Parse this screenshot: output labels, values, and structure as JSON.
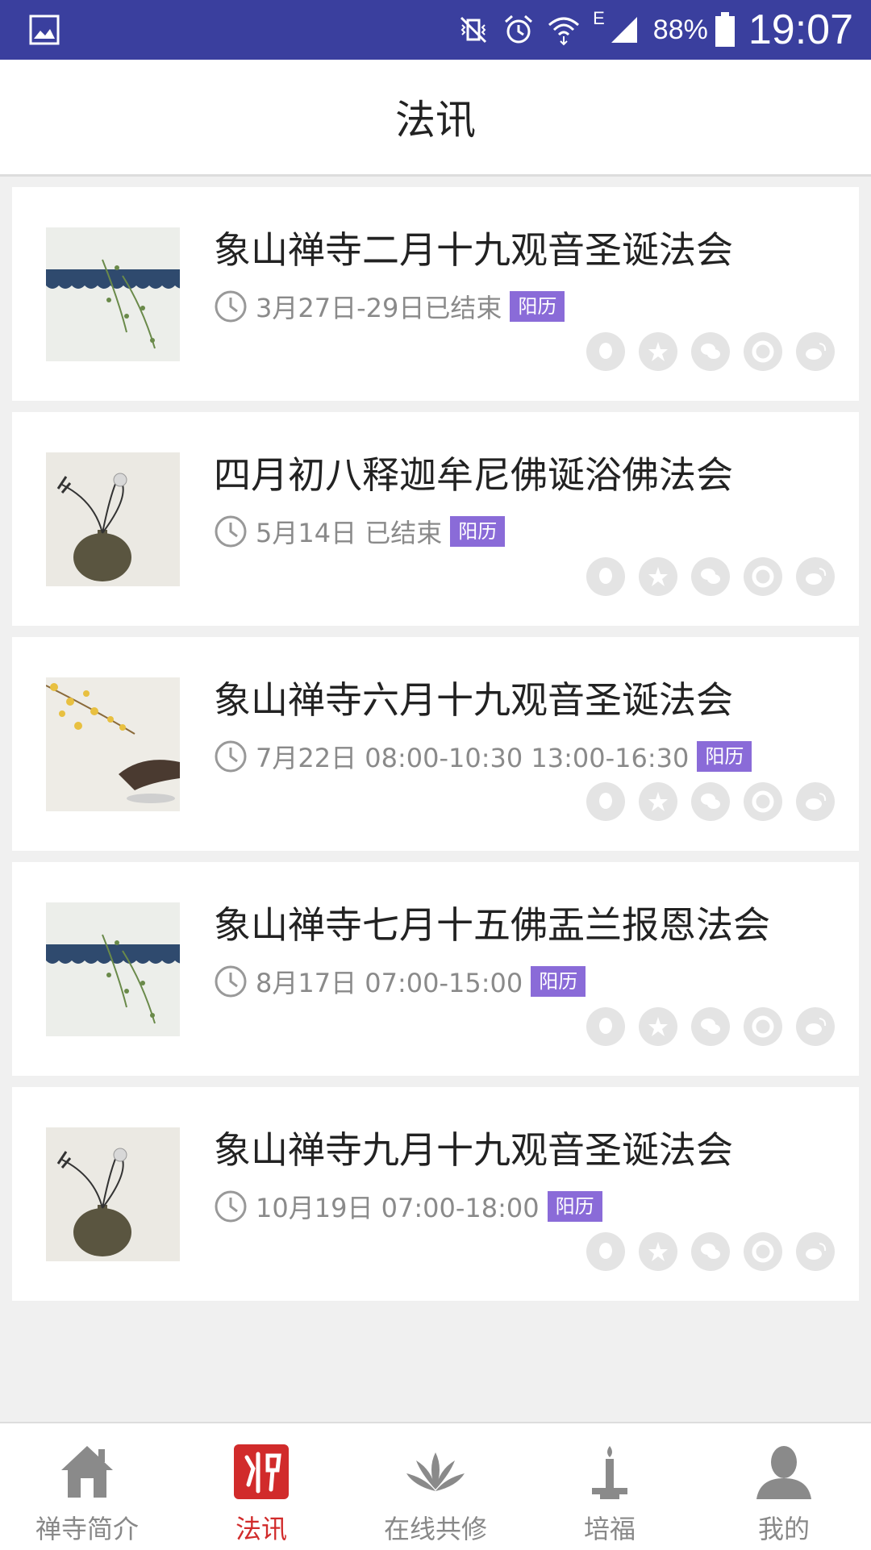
{
  "status_bar": {
    "network_label": "E",
    "battery_text": "88%",
    "time": "19:07",
    "icons": [
      "gallery-icon",
      "vibrate-icon",
      "alarm-icon",
      "wifi-icon",
      "signal-icon",
      "battery-icon"
    ]
  },
  "header": {
    "title": "法讯"
  },
  "events": [
    {
      "title": "象山禅寺二月十九观音圣诞法会",
      "time": "3月27日-29日已结束",
      "badge": "阳历",
      "thumb": "vine"
    },
    {
      "title": "四月初八释迦牟尼佛诞浴佛法会",
      "time": "5月14日 已结束",
      "badge": "阳历",
      "thumb": "vase"
    },
    {
      "title": "象山禅寺六月十九观音圣诞法会",
      "time": "7月22日 08:00-10:30 13:00-16:30",
      "badge": "阳历",
      "thumb": "bird"
    },
    {
      "title": "象山禅寺七月十五佛盂兰报恩法会",
      "time": "8月17日 07:00-15:00",
      "badge": "阳历",
      "thumb": "vine"
    },
    {
      "title": "象山禅寺九月十九观音圣诞法会",
      "time": "10月19日 07:00-18:00",
      "badge": "阳历",
      "thumb": "vase"
    }
  ],
  "share_icons": [
    "qq-icon",
    "qzone-icon",
    "wechat-icon",
    "moments-icon",
    "weibo-icon"
  ],
  "tabs": [
    {
      "label": "禅寺简介",
      "icon": "home-icon",
      "active": false
    },
    {
      "label": "法讯",
      "icon": "buddha-icon",
      "active": true
    },
    {
      "label": "在线共修",
      "icon": "lotus-icon",
      "active": false
    },
    {
      "label": "培福",
      "icon": "candle-icon",
      "active": false
    },
    {
      "label": "我的",
      "icon": "user-icon",
      "active": false
    }
  ],
  "colors": {
    "status_bar": "#3a3f9e",
    "badge": "#8a6bd8",
    "active_tab": "#d12b2b",
    "inactive_tab": "#888888"
  }
}
